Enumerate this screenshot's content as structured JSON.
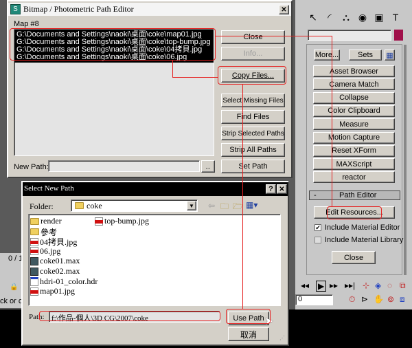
{
  "path_editor": {
    "title": "Bitmap / Photometric Path Editor",
    "close_x": "✕",
    "map_label": "Map #8",
    "files": [
      "G:\\Documents and Settings\\naoki\\桌面\\coke\\map01.jpg",
      "G:\\Documents and Settings\\naoki\\桌面\\coke\\top-bump.jpg",
      "G:\\Documents and Settings\\naoki\\桌面\\coke\\04拷貝.jpg",
      "G:\\Documents and Settings\\naoki\\桌面\\coke\\06.jpg"
    ],
    "buttons": {
      "close": "Close",
      "info": "Info...",
      "copy_files": "Copy Files...",
      "select_missing": "Select Missing Files",
      "find_files": "Find Files",
      "strip_selected": "Strip Selected Paths",
      "strip_all": "Strip All Paths",
      "set_path": "Set Path",
      "browse": "..."
    },
    "new_path_label": "New Path:",
    "new_path_value": ""
  },
  "select_path": {
    "title": "Select New Path",
    "help": "?",
    "close_x": "✕",
    "folder_label": "Folder:",
    "folder_value": "coke",
    "files": [
      {
        "name": "render",
        "type": "folder"
      },
      {
        "name": "參考",
        "type": "folder"
      },
      {
        "name": "04拷貝.jpg",
        "type": "jpg"
      },
      {
        "name": "06.jpg",
        "type": "jpg"
      },
      {
        "name": "coke01.max",
        "type": "max"
      },
      {
        "name": "coke02.max",
        "type": "max"
      },
      {
        "name": "hdri-01_color.hdr",
        "type": "hdr"
      },
      {
        "name": "map01.jpg",
        "type": "jpg"
      },
      {
        "name": "top-bump.jpg",
        "type": "jpg"
      }
    ],
    "path_label": "Path:",
    "path_value": "f:\\作品-個人\\3D CG\\2007\\coke",
    "use_path": "Use Path",
    "cancel": "取消"
  },
  "utilities": {
    "more": "More...",
    "sets": "Sets",
    "buttons": [
      "Asset Browser",
      "Camera Match",
      "Collapse",
      "Color Clipboard",
      "Measure",
      "Motion Capture",
      "Reset XForm",
      "MAXScript",
      "reactor"
    ],
    "rollout_collapse": "-",
    "rollout_title": "Path Editor",
    "edit_resources": "Edit Resources...",
    "include_material_editor": "Include Material Editor",
    "include_material_editor_checked": true,
    "include_material_library": "Include Material Library",
    "include_material_library_checked": false,
    "close": "Close",
    "frame_value": "0",
    "swatch_color": "#a0104a"
  },
  "background": {
    "frame_counter": "0 / 1",
    "status_text": "ck or cli"
  },
  "colors": {
    "annotation": "#e52020",
    "dialog_bg": "#d4d0c8"
  }
}
